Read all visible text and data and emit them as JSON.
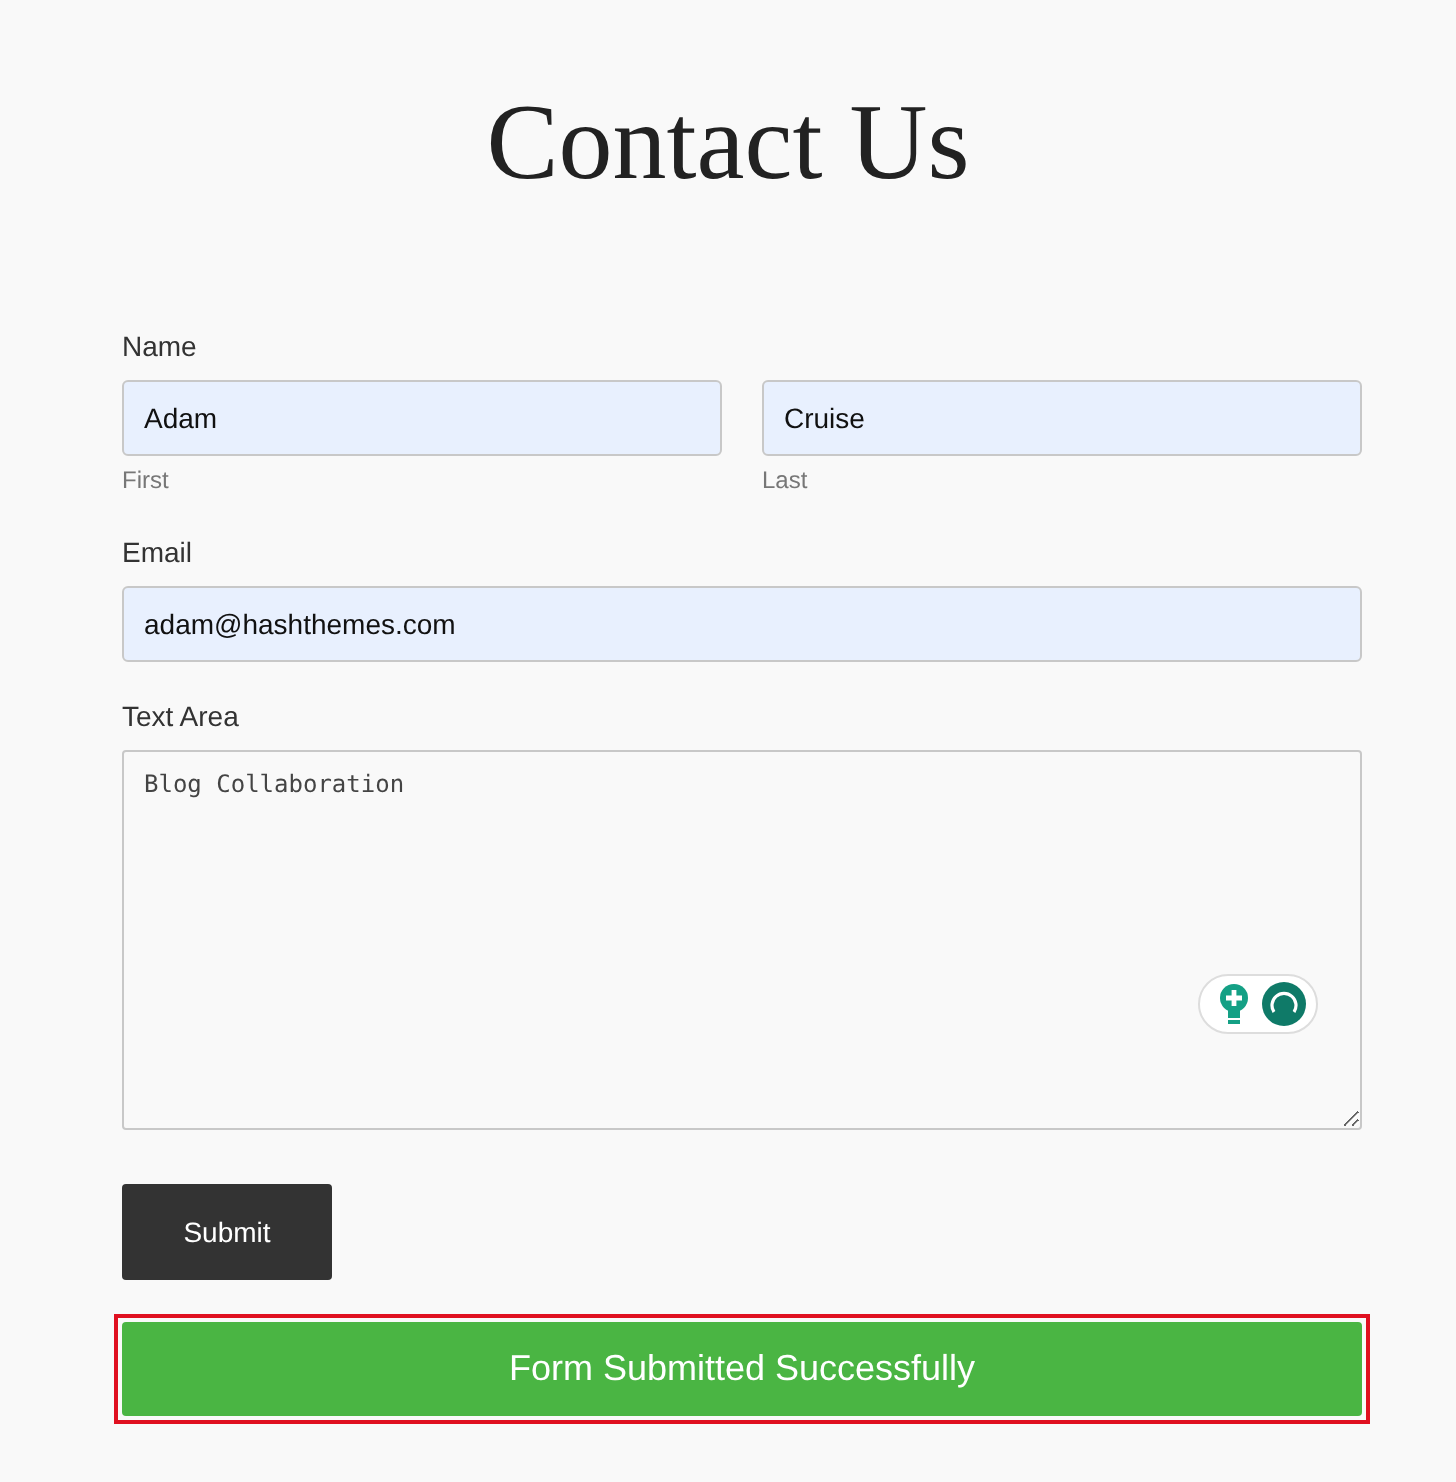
{
  "title": "Contact Us",
  "name": {
    "label": "Name",
    "first": {
      "value": "Adam",
      "sublabel": "First"
    },
    "last": {
      "value": "Cruise",
      "sublabel": "Last"
    }
  },
  "email": {
    "label": "Email",
    "value": "adam@hashthemes.com"
  },
  "text_area": {
    "label": "Text Area",
    "value": "Blog Collaboration"
  },
  "submit": {
    "label": "Submit"
  },
  "message": {
    "text": "Form Submitted Successfully",
    "highlighted": true
  }
}
